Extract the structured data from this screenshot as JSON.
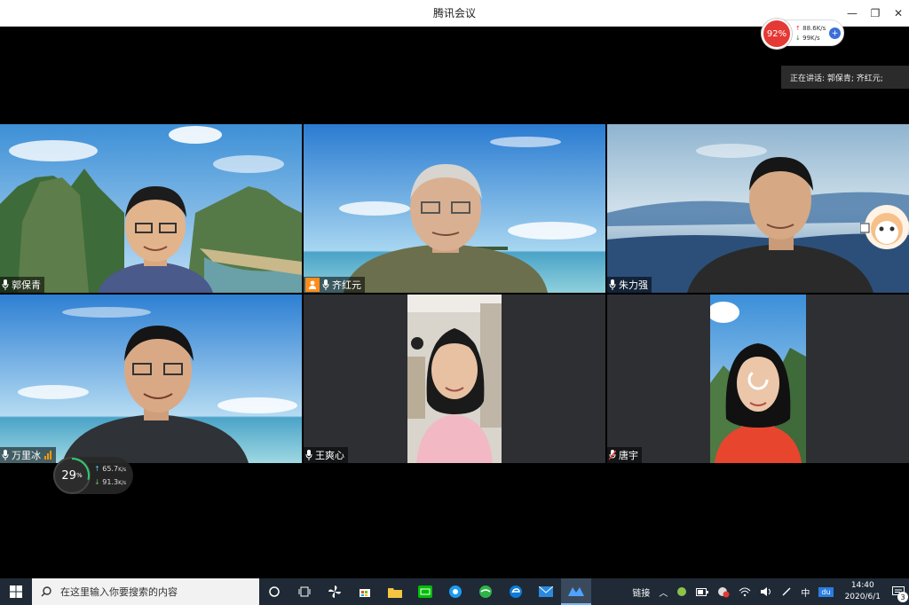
{
  "window": {
    "title": "腾讯会议",
    "minimize": "—",
    "restore": "❐",
    "close": "✕"
  },
  "netmon": {
    "percent": "92%",
    "upload": "88.6K/s",
    "download": "99K/s",
    "up_arrow": "↑",
    "down_arrow": "↓",
    "boost": "+"
  },
  "speaking": {
    "text": "正在讲话: 郭保青; 齐红元;"
  },
  "participants": [
    {
      "name": "郭保青"
    },
    {
      "name": "齐红元"
    },
    {
      "name": "朱力强"
    },
    {
      "name": "万里冰"
    },
    {
      "name": "王爽心"
    },
    {
      "name": "唐宇"
    }
  ],
  "gauge": {
    "value": "29",
    "unit": "%",
    "upload": "65.7",
    "download": "91.3",
    "rate_unit": "K/s",
    "up_arrow": "↑",
    "down_arrow": "↓",
    "fraction": 0.29
  },
  "taskbar": {
    "search_placeholder": "在这里输入你要搜索的内容",
    "link_label": "链接",
    "ime": "中",
    "ime2": "du",
    "time": "14:40",
    "date": "2020/6/1",
    "notifications": "3"
  },
  "colors": {
    "accent": "#3b6fd8",
    "alert_red": "#e53935",
    "host_badge": "#ff8c1a",
    "taskbar": "#1f2a36"
  }
}
